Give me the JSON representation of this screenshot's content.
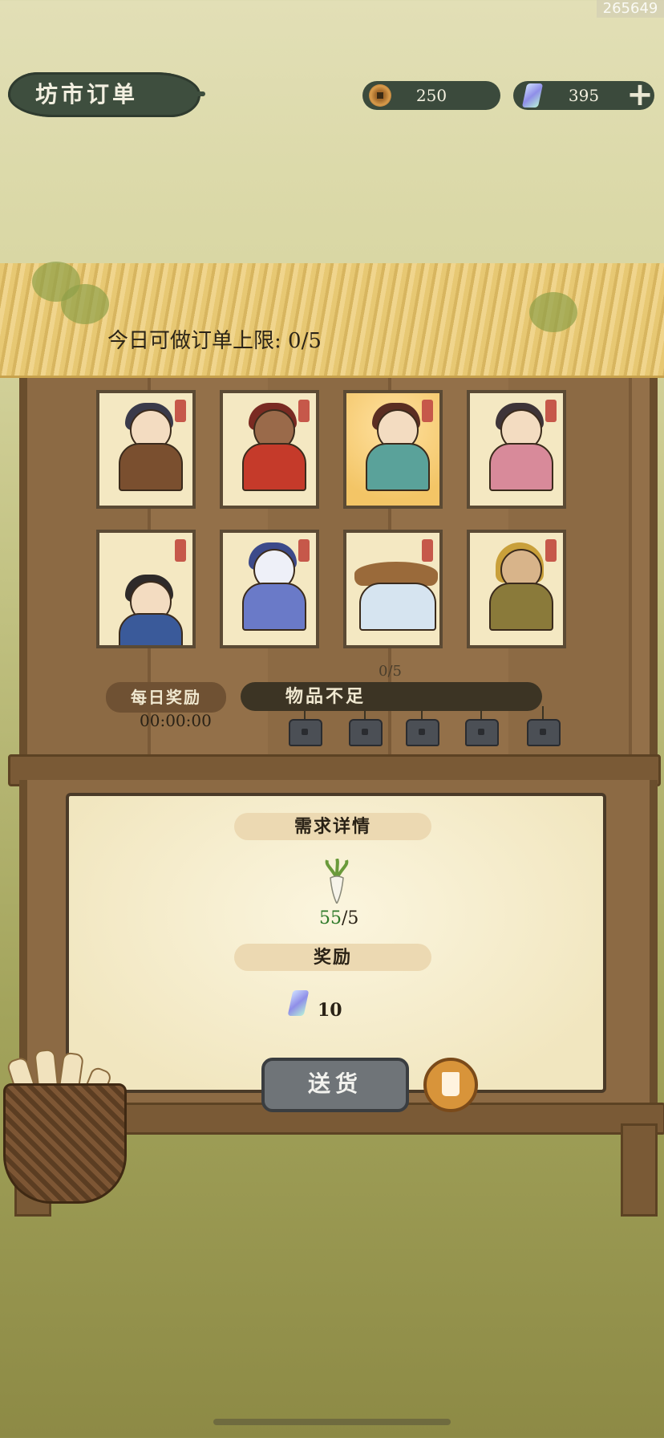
{
  "id_tag": "265649",
  "header": {
    "title": "坊市订单",
    "coins": "250",
    "gems": "395",
    "coin_icon": "copper-coin-icon",
    "gem_icon": "crystal-gem-icon",
    "plus_label": "+"
  },
  "orders": {
    "limit_text": "今日可做订单上限: 0/5",
    "characters": [
      {
        "name": "boy-with-radish"
      },
      {
        "name": "bull-demon"
      },
      {
        "name": "lady-golden"
      },
      {
        "name": "girl-with-fan"
      },
      {
        "name": "child-in-blue"
      },
      {
        "name": "dragon-maiden"
      },
      {
        "name": "straw-hat-figure"
      },
      {
        "name": "veiled-woman"
      }
    ],
    "progress_small": "0/5",
    "daily_reward_label": "每日奖励",
    "daily_timer": "00:00:00",
    "insufficient_label": "物品不足"
  },
  "details": {
    "demand_title": "需求详情",
    "item_icon": "radish-icon",
    "have": "55",
    "need": "/5",
    "reward_title": "奖励",
    "reward_icon": "crystal-gem-icon",
    "reward_value": "10",
    "deliver_label": "送货"
  }
}
